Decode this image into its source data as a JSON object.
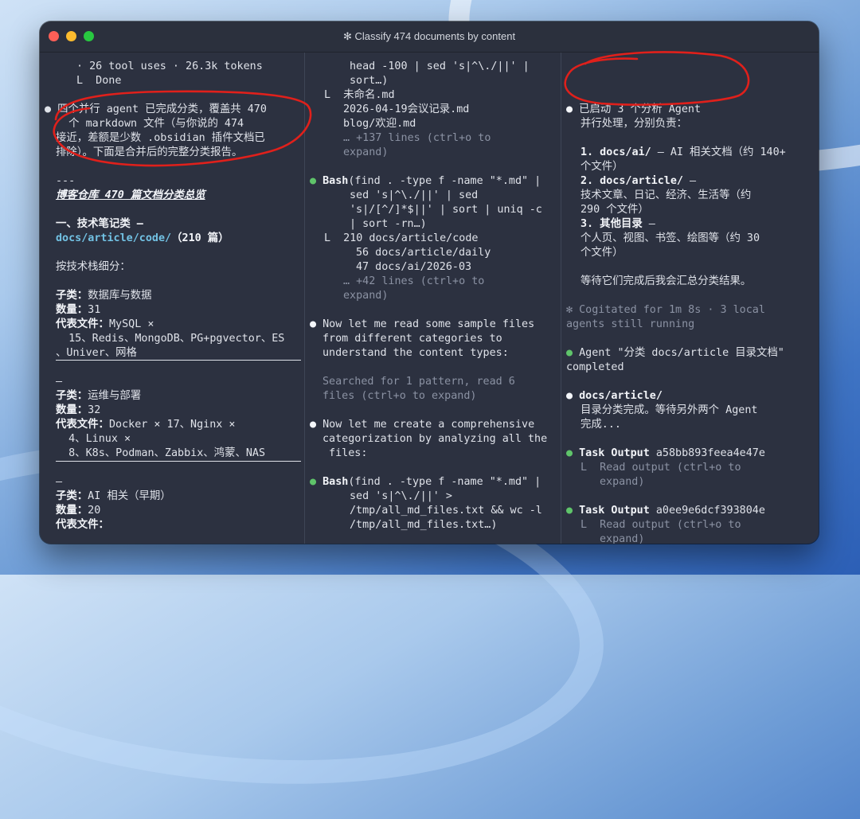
{
  "window": {
    "title": "✻ Classify 474 documents by content"
  },
  "left": {
    "l1": "· 26 tool uses · 26.3k tokens",
    "l2": "L  Done",
    "l3": "● 四个并行 agent 已完成分类，覆盖共 470",
    "l4": "  个 markdown 文件（与你说的 474",
    "l5": "接近，差额是少数 .obsidian 插件文档已",
    "l6": "排除）。下面是合并后的完整分类报告。",
    "l7": "---",
    "l8": "博客仓库 470 篇文档分类总览",
    "l9": "一、技术笔记类 —",
    "l10a": "docs/article/code/",
    "l10b": "（210 篇）",
    "l11": "按技术栈细分：",
    "l12a": "子类：",
    "l12b": "数据库与数据",
    "l13a": "数量：",
    "l13b": "31",
    "l14a": "代表文件：",
    "l14b": "MySQL ×",
    "l15": "  15、Redis、MongoDB、PG+pgvector、ES",
    "l16": "、Univer、网格",
    "l17": "—",
    "l18a": "子类：",
    "l18b": "运维与部署",
    "l19a": "数量：",
    "l19b": "32",
    "l20a": "代表文件：",
    "l20b": "Docker × 17、Nginx ×",
    "l21": "  4、Linux ×",
    "l22": "  8、K8s、Podman、Zabbix、鸿蒙、NAS",
    "l23": "—",
    "l24a": "子类：",
    "l24b": "AI 相关（早期）",
    "l25a": "数量：",
    "l25b": "20",
    "l26a": "代表文件："
  },
  "middle": {
    "m1": "head -100 | sed 's|^\\./||' |",
    "m2": "sort…)",
    "m3": "L  未命名.md",
    "m4": "2026-04-19会议记录.md",
    "m5": "blog/欢迎.md",
    "m6": "… +137 lines (ctrl+o to",
    "m7": "expand)",
    "m8a": "Bash",
    "m8b": "(find . -type f -name \"*.md\" |",
    "m9": "sed 's|^\\./||' | sed",
    "m10": "'s|/[^/]*$||' | sort | uniq -c",
    "m11": "| sort -rn…)",
    "m12": "L  210 docs/article/code",
    "m13": "56 docs/article/daily",
    "m14": "47 docs/ai/2026-03",
    "m15": "… +42 lines (ctrl+o to",
    "m16": "expand)",
    "m17": "Now let me read some sample files",
    "m18": "from different categories to",
    "m19": "understand the content types:",
    "m20": "Searched for 1 pattern, read 6",
    "m21": "files (ctrl+o to expand)",
    "m22": "Now let me create a comprehensive",
    "m23": "categorization by analyzing all the",
    "m24": " files:",
    "m25a": "Bash",
    "m25b": "(find . -type f -name \"*.md\" |",
    "m26": "sed 's|^\\./||' >",
    "m27": "/tmp/all_md_files.txt && wc -l",
    "m28": "/tmp/all_md_files.txt…)"
  },
  "right": {
    "r1": "已启动 3 个分析 Agent",
    "r2": "并行处理，分别负责：",
    "r3a": "1. docs/ai/",
    "r3b": " — AI 相关文档（约 140+",
    "r4": "个文件）",
    "r5a": "2. docs/article/",
    "r5b": " —",
    "r6": "技术文章、日记、经济、生活等（约",
    "r7": "290 个文件）",
    "r8a": "3. 其他目录",
    "r8b": " —",
    "r9": "个人页、视图、书签、绘图等（约 30",
    "r10": "个文件）",
    "r11": "等待它们完成后我会汇总分类结果。",
    "r12": "✻ Cogitated for 1m 8s · 3 local",
    "r13": "agents still running",
    "r14": "Agent \"分类 docs/article 目录文档\"",
    "r15": "completed",
    "r16": "docs/article/",
    "r17": "目录分类完成。等待另外两个 Agent",
    "r18": "完成...",
    "r19a": "Task Output",
    "r19b": " a58bb893feea4e47e",
    "r20": "L  Read output (ctrl+o to",
    "r21": "expand)",
    "r22a": "Task Output",
    "r22b": " a0ee9e6dcf393804e",
    "r23": "L  Read output (ctrl+o to",
    "r24": "expand)"
  },
  "colors": {
    "terminal_bg": "#2c3140",
    "text": "#dfe2e9",
    "dim_text": "#8b92a3",
    "success_dot": "#5fc46a",
    "path_highlight": "#72c2e4",
    "annotation": "#e0201b"
  },
  "icons": [
    "close-light",
    "minimize-light",
    "zoom-light",
    "white-bullet-icon",
    "green-bullet-icon"
  ]
}
